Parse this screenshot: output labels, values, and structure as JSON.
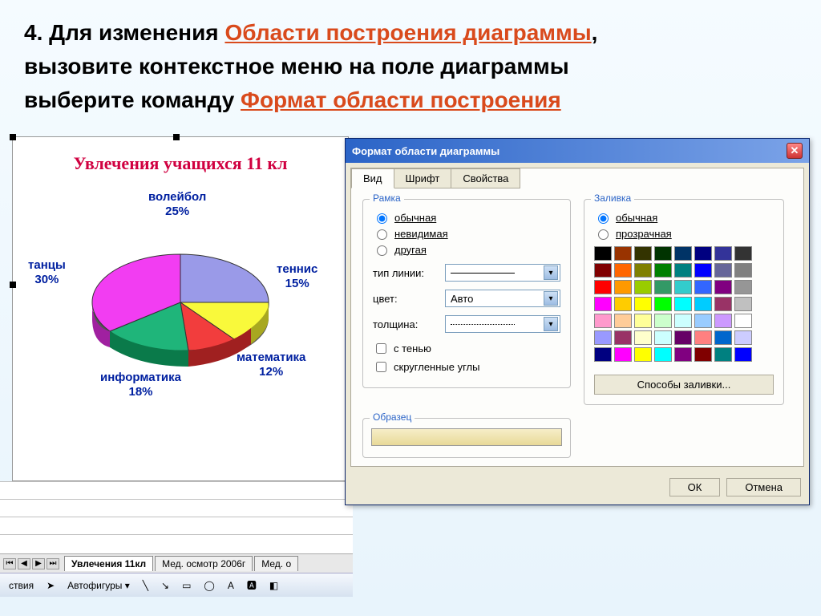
{
  "instruction": {
    "line1_prefix": "4. Для изменения ",
    "line1_hl": "Области построения диаграммы",
    "line1_suffix": ",",
    "line2": " вызовите контекстное меню на поле диаграммы",
    "line3_prefix": "выберите команду ",
    "line3_hl": "Формат области построения"
  },
  "chart_title": "Увлечения  учащихся  11 кл",
  "chart_data": {
    "type": "pie",
    "title": "Увлечения учащихся 11 кл",
    "series": [
      {
        "name": "волейбол",
        "value": 25,
        "label": "25%",
        "color": "#9a9ae8"
      },
      {
        "name": "теннис",
        "value": 15,
        "label": "15%",
        "color": "#f9f93b"
      },
      {
        "name": "математика",
        "value": 12,
        "label": "12%",
        "color": "#f23d3d"
      },
      {
        "name": "информатика",
        "value": 18,
        "label": "18%",
        "color": "#1fb57a"
      },
      {
        "name": "танцы",
        "value": 30,
        "label": "30%",
        "color": "#f23df2"
      }
    ]
  },
  "sheet_tabs": {
    "active": "Увлечения 11кл",
    "tab2": "Мед. осмотр 2006г",
    "tab3": "Мед. о"
  },
  "toolbar": {
    "status": "ствия",
    "autoshapes": "Автофигуры"
  },
  "dialog": {
    "title": "Формат области диаграммы",
    "tabs": {
      "view": "Вид",
      "font": "Шрифт",
      "props": "Свойства"
    },
    "frame": {
      "legend": "Рамка",
      "opt_normal": "обычная",
      "opt_invisible": "невидимая",
      "opt_other": "другая",
      "line_type": "тип линии:",
      "color": "цвет:",
      "color_value": "Авто",
      "thickness": "толщина:",
      "shadow": "с тенью",
      "rounded": "скругленные углы"
    },
    "fill": {
      "legend": "Заливка",
      "opt_normal": "обычная",
      "opt_transparent": "прозрачная",
      "methods_btn": "Способы заливки..."
    },
    "sample_legend": "Образец",
    "ok": "ОК",
    "cancel": "Отмена"
  },
  "palette_colors": [
    "#000000",
    "#993300",
    "#333300",
    "#003300",
    "#003366",
    "#000080",
    "#333399",
    "#333333",
    "#800000",
    "#ff6600",
    "#808000",
    "#008000",
    "#008080",
    "#0000ff",
    "#666699",
    "#808080",
    "#ff0000",
    "#ff9900",
    "#99cc00",
    "#339966",
    "#33cccc",
    "#3366ff",
    "#800080",
    "#969696",
    "#ff00ff",
    "#ffcc00",
    "#ffff00",
    "#00ff00",
    "#00ffff",
    "#00ccff",
    "#993366",
    "#c0c0c0",
    "#ff99cc",
    "#ffcc99",
    "#ffff99",
    "#ccffcc",
    "#ccffff",
    "#99ccff",
    "#cc99ff",
    "#ffffff",
    "#9999ff",
    "#993366",
    "#ffffcc",
    "#ccffff",
    "#660066",
    "#ff8080",
    "#0066cc",
    "#ccccff",
    "#000080",
    "#ff00ff",
    "#ffff00",
    "#00ffff",
    "#800080",
    "#800000",
    "#008080",
    "#0000ff"
  ]
}
